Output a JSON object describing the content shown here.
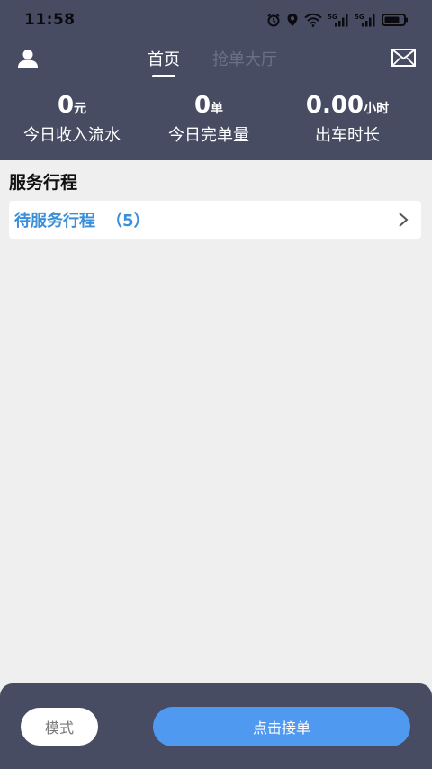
{
  "status_bar": {
    "time": "11:58",
    "icons": [
      "alarm-icon",
      "location-icon",
      "wifi-icon",
      "5g-signal-icon",
      "5g-signal-icon",
      "battery-icon"
    ],
    "signal_labels": [
      "5G",
      "5G"
    ],
    "battery_level": 0.8
  },
  "nav": {
    "profile_icon": "person-icon",
    "mail_icon": "mail-icon",
    "tabs": [
      {
        "label": "首页",
        "active": true
      },
      {
        "label": "抢单大厅",
        "active": false
      }
    ]
  },
  "stats": [
    {
      "value": "0",
      "unit": "元",
      "label": "今日收入流水"
    },
    {
      "value": "0",
      "unit": "单",
      "label": "今日完单量"
    },
    {
      "value": "0.00",
      "unit": "小时",
      "label": "出车时长"
    }
  ],
  "section": {
    "title": "服务行程"
  },
  "trip": {
    "label": "待服务行程",
    "count": "（5）",
    "chevron_icon": "chevron-right-icon"
  },
  "bottom": {
    "mode_label": "模式",
    "accept_label": "点击接单"
  },
  "colors": {
    "header_bg": "#474c63",
    "accent_blue": "#4f9af0",
    "link_blue": "#3b8ed9",
    "content_bg": "#efefef"
  }
}
